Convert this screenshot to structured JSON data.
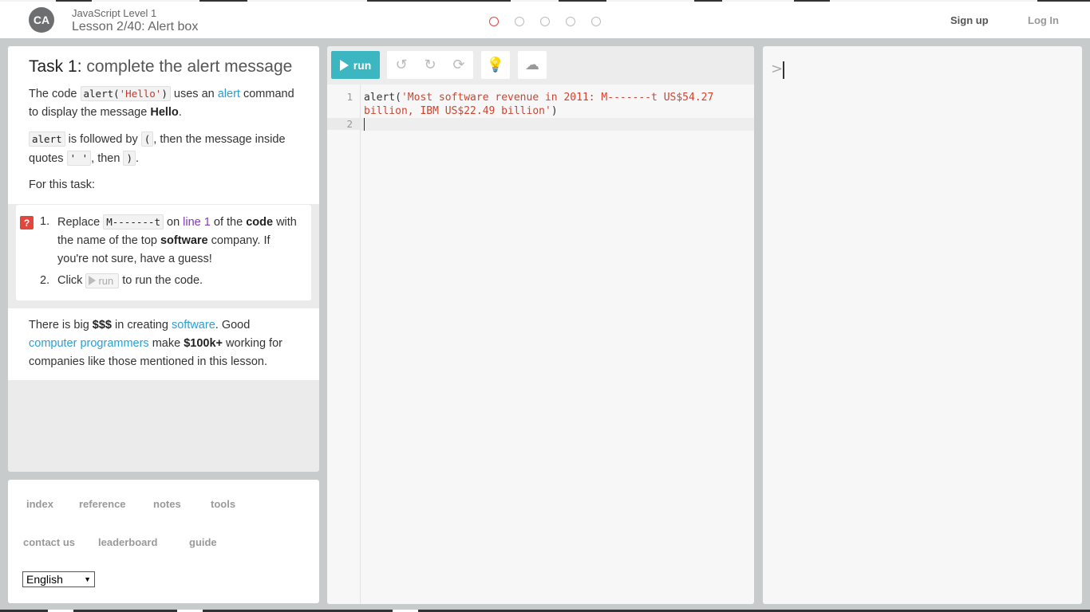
{
  "header": {
    "logo_text": "CA",
    "level": "JavaScript Level 1",
    "lesson": "Lesson 2/40: Alert box",
    "signup": "Sign up",
    "login": "Log In"
  },
  "task": {
    "number": "Task 1:",
    "title": "complete the alert message",
    "p1_a": "The code",
    "p1_code_fn": "alert(",
    "p1_code_str": "'Hello'",
    "p1_code_close": ")",
    "p1_b": "uses an",
    "p1_link": "alert",
    "p1_c": "command to display the message",
    "p1_bold": "Hello",
    "p1_end": ".",
    "p2_code1": "alert",
    "p2_a": "is followed by",
    "p2_code2": "(",
    "p2_b": ", then the message inside quotes",
    "p2_code3": "' '",
    "p2_c": ", then",
    "p2_code4": ")",
    "p2_end": ".",
    "p3": "For this task:"
  },
  "instructions": {
    "qmark": "?",
    "s1_num": "1.",
    "s1_a": "Replace",
    "s1_code": "M-------t",
    "s1_b": "on",
    "s1_line": "line 1",
    "s1_c": "of the",
    "s1_bold": "code",
    "s1_d": "with the name of the top",
    "s1_bold2": "software",
    "s1_e": "company. If you're not sure, have a guess!",
    "s2_num": "2.",
    "s2_a": "Click",
    "s2_run": "run",
    "s2_b": "to run the code."
  },
  "info": {
    "a": "There is big",
    "money": "$$$",
    "b": "in creating",
    "link1": "software",
    "c": ". Good",
    "link2": "computer programmers",
    "d": "make",
    "salary": "$100k+",
    "e": "working for companies like those mentioned in this lesson."
  },
  "nav": {
    "index": "index",
    "reference": "reference",
    "notes": "notes",
    "tools": "tools",
    "contact": "contact us",
    "leaderboard": "leaderboard",
    "guide": "guide",
    "language": "English"
  },
  "editor": {
    "run_label": "run",
    "line1_num": "1",
    "line2_num": "2",
    "code_fn": "alert(",
    "code_str": "'Most software revenue in 2011: M-------t US$54.27 billion, IBM US$22.49 billion'",
    "code_close": ")"
  },
  "console": {
    "prompt": ">"
  },
  "colors": {
    "accent": "#3cb7c2",
    "link": "#2a9fd6",
    "error": "#e0483e",
    "purple": "#7e3ab7"
  }
}
